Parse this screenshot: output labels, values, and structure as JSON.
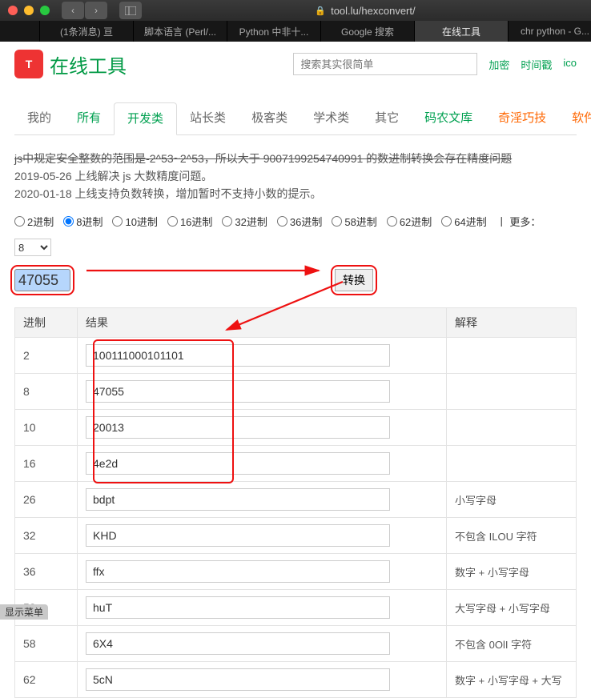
{
  "browser": {
    "url": "tool.lu/hexconvert/",
    "tabs": [
      "(1条消息) 亘",
      "脚本语言 (Perl/...",
      "Python 中非十...",
      "Google 搜索",
      "在线工具",
      "chr python - G..."
    ],
    "active_tab_index": 4
  },
  "site": {
    "logo_letter": "T",
    "name": "在线工具",
    "search_placeholder": "搜索其实很简单",
    "quick_links": [
      "加密",
      "时间戳",
      "ico"
    ]
  },
  "nav": {
    "items": [
      "我的",
      "所有",
      "开发类",
      "站长类",
      "极客类",
      "学术类",
      "其它",
      "码农文库",
      "奇淫巧技",
      "软件推"
    ],
    "active_index": 2
  },
  "desc": {
    "line1": "js中规定安全整数的范围是-2^53~2^53，所以大于 9007199254740991 的数进制转换会存在精度问题",
    "line2": "2019-05-26 上线解决 js 大数精度问题。",
    "line3": "2020-01-18 上线支持负数转换，增加暂时不支持小数的提示。"
  },
  "radios": {
    "options": [
      "2进制",
      "8进制",
      "10进制",
      "16进制",
      "32进制",
      "36进制",
      "58进制",
      "62进制",
      "64进制"
    ],
    "checked_index": 1,
    "more_sep": "丨 更多：",
    "more_value": "8"
  },
  "input": {
    "value": "47055",
    "convert_label": "转换"
  },
  "table": {
    "headers": [
      "进制",
      "结果",
      "解释"
    ],
    "rows": [
      {
        "base": "2",
        "val": "100111000101101",
        "expl": ""
      },
      {
        "base": "8",
        "val": "47055",
        "expl": ""
      },
      {
        "base": "10",
        "val": "20013",
        "expl": ""
      },
      {
        "base": "16",
        "val": "4e2d",
        "expl": ""
      },
      {
        "base": "26",
        "val": "bdpt",
        "expl": "小写字母"
      },
      {
        "base": "32",
        "val": "KHD",
        "expl": "不包含 ILOU 字符"
      },
      {
        "base": "36",
        "val": "ffx",
        "expl": "数字 + 小写字母"
      },
      {
        "base": "52",
        "val": "huT",
        "expl": "大写字母 + 小写字母"
      },
      {
        "base": "58",
        "val": "6X4",
        "expl": "不包含 0OlI 字符"
      },
      {
        "base": "62",
        "val": "5cN",
        "expl": "数字 + 小写字母 + 大写"
      }
    ]
  },
  "status_badge": "显示菜单"
}
